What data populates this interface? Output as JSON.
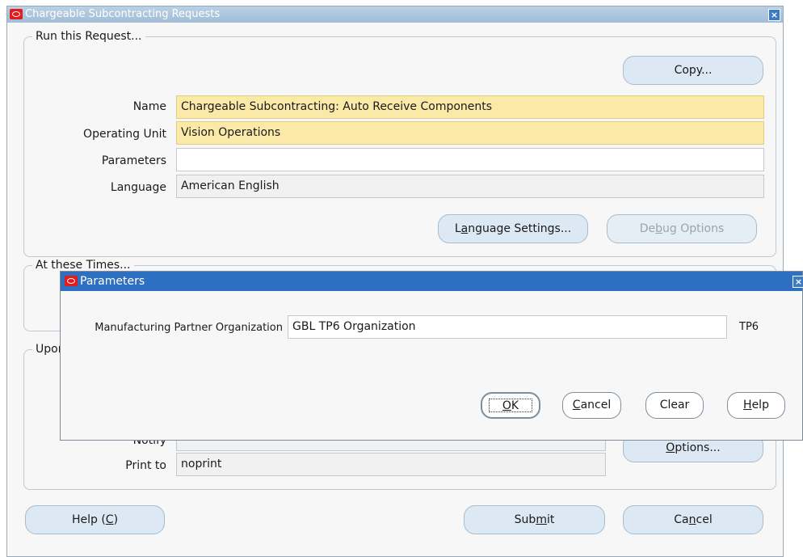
{
  "window": {
    "title": "Chargeable Subcontracting Requests"
  },
  "run_group": {
    "legend": "Run this Request...",
    "copy_label": "Copy...",
    "name_label": "Name",
    "name_value": "Chargeable Subcontracting: Auto Receive Components",
    "ou_label": "Operating Unit",
    "ou_value": "Vision Operations",
    "params_label": "Parameters",
    "params_value": "",
    "lang_label": "Language",
    "lang_value": "American English",
    "lang_settings": {
      "pre": "L",
      "u": "a",
      "post": "nguage Settings..."
    },
    "debug": {
      "pre": "De",
      "u": "b",
      "post": "ug Options"
    }
  },
  "times_group": {
    "legend": "At these Times..."
  },
  "upon_group": {
    "legend": "Upon Completion...",
    "notify_label": "Notify",
    "print_label": "Print to",
    "print_value": "noprint",
    "options": {
      "u": "O",
      "post": "ptions..."
    }
  },
  "footer": {
    "help": {
      "pre": "Help (",
      "u": "C",
      "post": ")"
    },
    "submit": {
      "pre": "Sub",
      "u": "m",
      "post": "it"
    },
    "cancel": {
      "pre": "Ca",
      "u": "n",
      "post": "cel"
    }
  },
  "dialog": {
    "title": "Parameters",
    "field_label": "Manufacturing Partner Organization",
    "field_value": "GBL TP6 Organization",
    "code": "TP6",
    "ok": {
      "u": "O",
      "post": "K"
    },
    "cancel": {
      "u": "C",
      "post": "ancel"
    },
    "clear": "Clear",
    "help": {
      "u": "H",
      "post": "elp"
    }
  },
  "colors": {
    "required_field": "#fbe9a8",
    "dialog_title": "#2d6fc0",
    "button": "#dce8f4"
  }
}
